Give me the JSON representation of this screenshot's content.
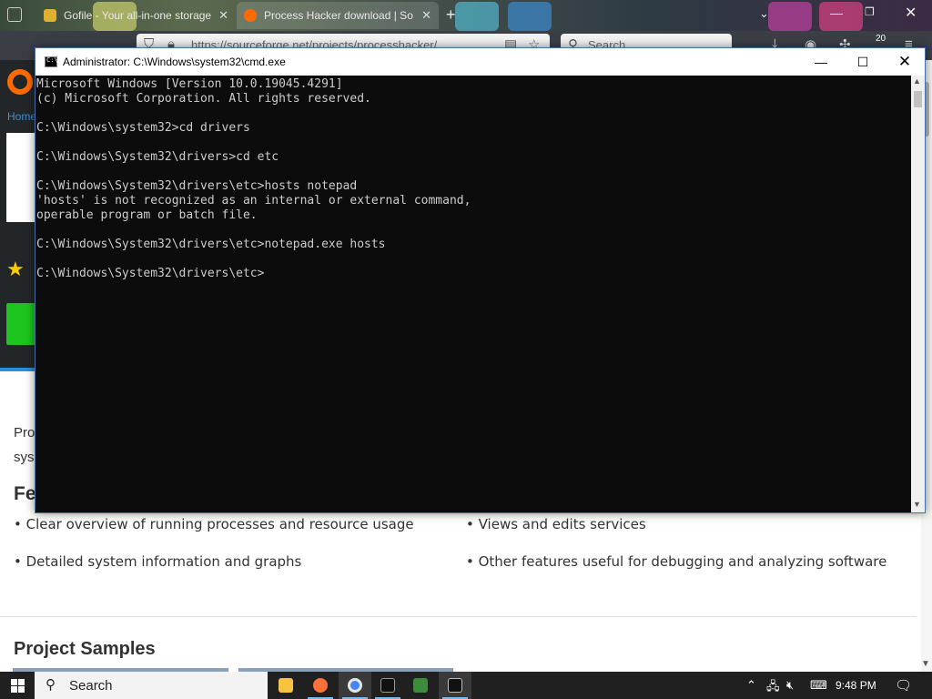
{
  "browser": {
    "tabs": [
      {
        "label": "Gofile - Your all-in-one storage",
        "close": "✕"
      },
      {
        "label": "Process Hacker download | So",
        "close": "✕"
      }
    ],
    "new_tab": "+",
    "url": "https://sourceforge.net/projects/processhacker/",
    "search_placeholder": "Search",
    "notification_count": "20",
    "window_buttons": {
      "minimize": "—",
      "restore": "❐",
      "close": "✕"
    }
  },
  "page": {
    "breadcrumb_home": "Home",
    "intro_line1": "Pro",
    "intro_line2": "sys",
    "features_heading": "Fea",
    "features": [
      "• Clear overview of running processes and resource usage",
      "• Views and edits services",
      "• Detailed system information and graphs",
      "• Other features useful for debugging and analyzing software"
    ],
    "samples_heading": "Project Samples"
  },
  "cmd": {
    "title": "Administrator: C:\\Windows\\system32\\cmd.exe",
    "buttons": {
      "minimize": "—",
      "maximize": "☐",
      "close": "✕"
    },
    "lines": [
      "Microsoft Windows [Version 10.0.19045.4291]",
      "(c) Microsoft Corporation. All rights reserved.",
      "",
      "C:\\Windows\\system32>cd drivers",
      "",
      "C:\\Windows\\System32\\drivers>cd etc",
      "",
      "C:\\Windows\\System32\\drivers\\etc>hosts notepad",
      "'hosts' is not recognized as an internal or external command,",
      "operable program or batch file.",
      "",
      "C:\\Windows\\System32\\drivers\\etc>notepad.exe hosts",
      "",
      "C:\\Windows\\System32\\drivers\\etc>"
    ]
  },
  "taskbar": {
    "search_label": "Search",
    "time": "9:48 PM",
    "colors": {
      "accent": "#76b9ed",
      "taskbar_bg": "#202020"
    }
  }
}
